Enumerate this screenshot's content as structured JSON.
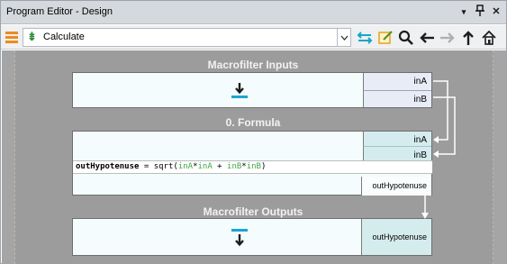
{
  "window": {
    "title": "Program Editor - Design",
    "buttons": {
      "dropdown": "▾",
      "pin": "ᛜ",
      "close": "✕"
    }
  },
  "toolbar": {
    "selected_item": "Calculate",
    "icons": [
      "menu-icon",
      "formula-kind-icon",
      "dropdown-arrow-icon",
      "swap-icon",
      "edit-icon",
      "search-icon",
      "back-arrow-icon",
      "forward-arrow-icon",
      "up-arrow-icon",
      "home-icon"
    ],
    "colors": {
      "menu": "#ee8a1e",
      "swap": "#14a6c8",
      "edit": "#e6a21e",
      "accent": "#2f8a3a"
    }
  },
  "canvas": {
    "inputs": {
      "title": "Macrofilter Inputs",
      "ports": [
        "inA",
        "inB"
      ]
    },
    "formula": {
      "title": "0. Formula",
      "inputs": [
        "inA",
        "inB"
      ],
      "expression": {
        "lhs": "outHypotenuse",
        "eq": " = ",
        "fn": "sqrt(",
        "a1": "inA",
        "star1": "*",
        "a2": "inA",
        "plus": " + ",
        "b1": "inB",
        "star2": "*",
        "b2": "inB",
        "close": ")"
      },
      "outputs": [
        "outHypotenuse"
      ]
    },
    "outputs": {
      "title": "Macrofilter Outputs",
      "ports": [
        "outHypotenuse"
      ]
    }
  }
}
